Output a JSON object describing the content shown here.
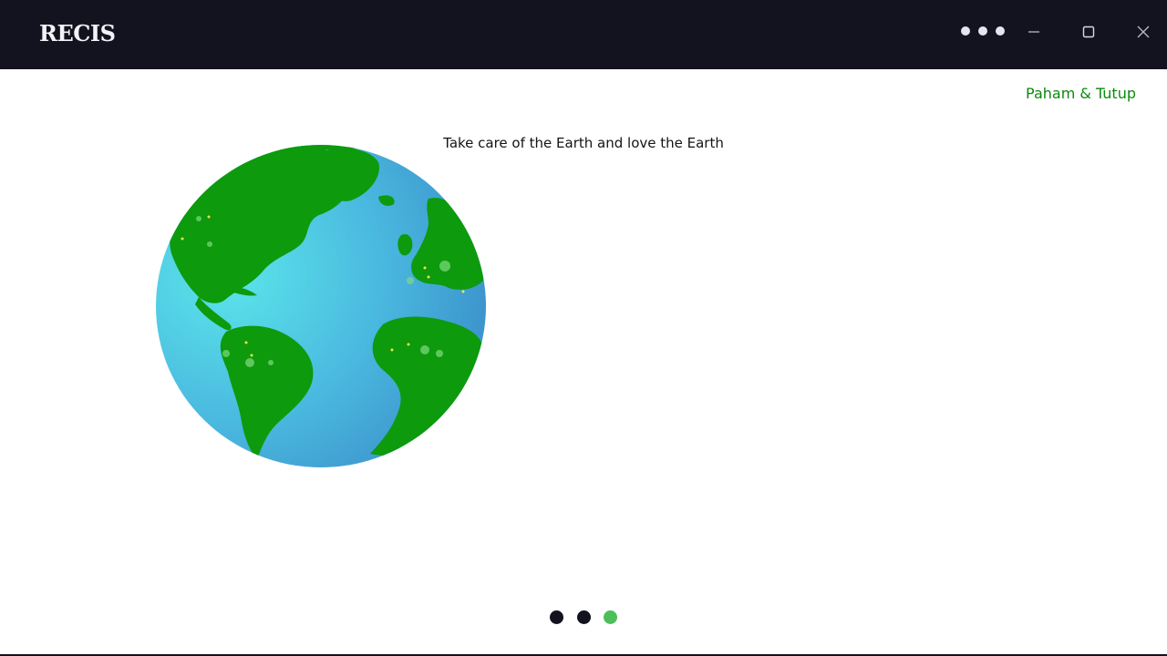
{
  "window": {
    "title": "RECIS"
  },
  "main": {
    "understand_close_label": "Paham & Tutup",
    "tagline": "Take care of the Earth and love the Earth"
  },
  "pager": {
    "count": 3,
    "active_index": 2,
    "dots": [
      {
        "color": "#13121f"
      },
      {
        "color": "#13121f"
      },
      {
        "color": "#4cbf5a"
      }
    ]
  },
  "colors": {
    "titlebar": "#13121f",
    "link": "#0b8a0b",
    "land": "#0d9a0d",
    "ocean_light": "#5be6ea",
    "ocean_dark": "#3a96cc"
  },
  "icons": {
    "menu": "more-dots-icon",
    "minimize": "minimize-icon",
    "maximize": "maximize-icon",
    "close": "close-icon"
  }
}
